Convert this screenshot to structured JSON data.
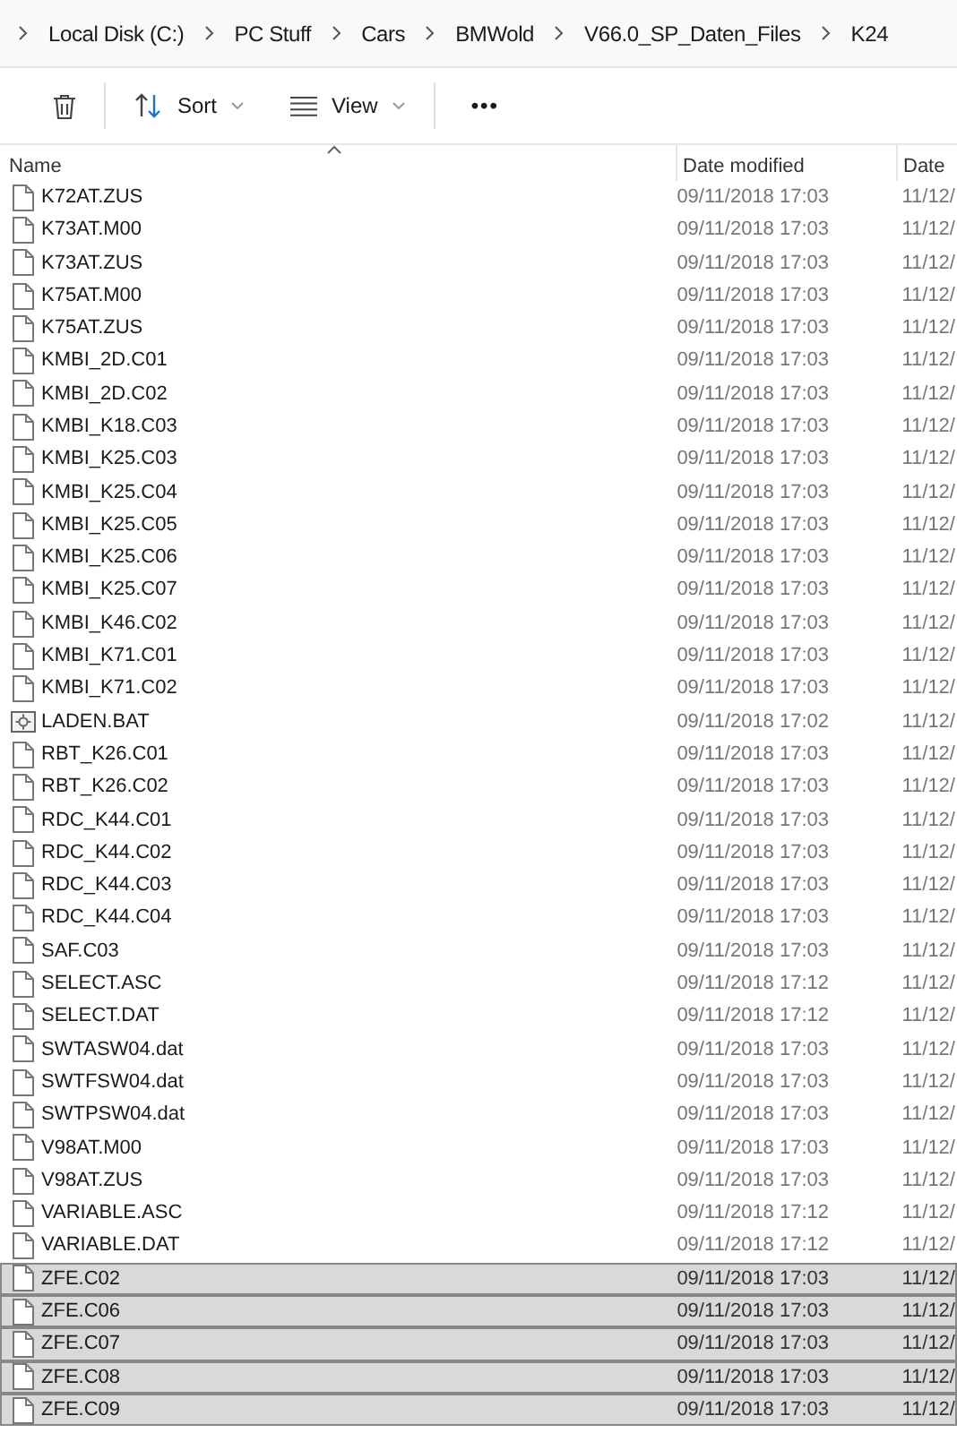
{
  "breadcrumb": [
    "Local Disk (C:)",
    "PC Stuff",
    "Cars",
    "BMWold",
    "V66.0_SP_Daten_Files",
    "K24"
  ],
  "toolbar": {
    "sort": "Sort",
    "view": "View",
    "more": "•••"
  },
  "columns": [
    "Name",
    "Date modified",
    "Date"
  ],
  "files": [
    {
      "name": "K72AT.ZUS",
      "date": "09/11/2018 17:03",
      "column_3": "11/12/",
      "kind": "file",
      "selected": false
    },
    {
      "name": "K73AT.M00",
      "date": "09/11/2018 17:03",
      "column_3": "11/12/",
      "kind": "file",
      "selected": false
    },
    {
      "name": "K73AT.ZUS",
      "date": "09/11/2018 17:03",
      "column_3": "11/12/",
      "kind": "file",
      "selected": false
    },
    {
      "name": "K75AT.M00",
      "date": "09/11/2018 17:03",
      "column_3": "11/12/",
      "kind": "file",
      "selected": false
    },
    {
      "name": "K75AT.ZUS",
      "date": "09/11/2018 17:03",
      "column_3": "11/12/",
      "kind": "file",
      "selected": false
    },
    {
      "name": "KMBI_2D.C01",
      "date": "09/11/2018 17:03",
      "column_3": "11/12/",
      "kind": "file",
      "selected": false
    },
    {
      "name": "KMBI_2D.C02",
      "date": "09/11/2018 17:03",
      "column_3": "11/12/",
      "kind": "file",
      "selected": false
    },
    {
      "name": "KMBI_K18.C03",
      "date": "09/11/2018 17:03",
      "column_3": "11/12/",
      "kind": "file",
      "selected": false
    },
    {
      "name": "KMBI_K25.C03",
      "date": "09/11/2018 17:03",
      "column_3": "11/12/",
      "kind": "file",
      "selected": false
    },
    {
      "name": "KMBI_K25.C04",
      "date": "09/11/2018 17:03",
      "column_3": "11/12/",
      "kind": "file",
      "selected": false
    },
    {
      "name": "KMBI_K25.C05",
      "date": "09/11/2018 17:03",
      "column_3": "11/12/",
      "kind": "file",
      "selected": false
    },
    {
      "name": "KMBI_K25.C06",
      "date": "09/11/2018 17:03",
      "column_3": "11/12/",
      "kind": "file",
      "selected": false
    },
    {
      "name": "KMBI_K25.C07",
      "date": "09/11/2018 17:03",
      "column_3": "11/12/",
      "kind": "file",
      "selected": false
    },
    {
      "name": "KMBI_K46.C02",
      "date": "09/11/2018 17:03",
      "column_3": "11/12/",
      "kind": "file",
      "selected": false
    },
    {
      "name": "KMBI_K71.C01",
      "date": "09/11/2018 17:03",
      "column_3": "11/12/",
      "kind": "file",
      "selected": false
    },
    {
      "name": "KMBI_K71.C02",
      "date": "09/11/2018 17:03",
      "column_3": "11/12/",
      "kind": "file",
      "selected": false
    },
    {
      "name": "LADEN.BAT",
      "date": "09/11/2018 17:02",
      "column_3": "11/12/",
      "kind": "batch",
      "selected": false
    },
    {
      "name": "RBT_K26.C01",
      "date": "09/11/2018 17:03",
      "column_3": "11/12/",
      "kind": "file",
      "selected": false
    },
    {
      "name": "RBT_K26.C02",
      "date": "09/11/2018 17:03",
      "column_3": "11/12/",
      "kind": "file",
      "selected": false
    },
    {
      "name": "RDC_K44.C01",
      "date": "09/11/2018 17:03",
      "column_3": "11/12/",
      "kind": "file",
      "selected": false
    },
    {
      "name": "RDC_K44.C02",
      "date": "09/11/2018 17:03",
      "column_3": "11/12/",
      "kind": "file",
      "selected": false
    },
    {
      "name": "RDC_K44.C03",
      "date": "09/11/2018 17:03",
      "column_3": "11/12/",
      "kind": "file",
      "selected": false
    },
    {
      "name": "RDC_K44.C04",
      "date": "09/11/2018 17:03",
      "column_3": "11/12/",
      "kind": "file",
      "selected": false
    },
    {
      "name": "SAF.C03",
      "date": "09/11/2018 17:03",
      "column_3": "11/12/",
      "kind": "file",
      "selected": false
    },
    {
      "name": "SELECT.ASC",
      "date": "09/11/2018 17:12",
      "column_3": "11/12/",
      "kind": "file",
      "selected": false
    },
    {
      "name": "SELECT.DAT",
      "date": "09/11/2018 17:12",
      "column_3": "11/12/",
      "kind": "file",
      "selected": false
    },
    {
      "name": "SWTASW04.dat",
      "date": "09/11/2018 17:03",
      "column_3": "11/12/",
      "kind": "file",
      "selected": false
    },
    {
      "name": "SWTFSW04.dat",
      "date": "09/11/2018 17:03",
      "column_3": "11/12/",
      "kind": "file",
      "selected": false
    },
    {
      "name": "SWTPSW04.dat",
      "date": "09/11/2018 17:03",
      "column_3": "11/12/",
      "kind": "file",
      "selected": false
    },
    {
      "name": "V98AT.M00",
      "date": "09/11/2018 17:03",
      "column_3": "11/12/",
      "kind": "file",
      "selected": false
    },
    {
      "name": "V98AT.ZUS",
      "date": "09/11/2018 17:03",
      "column_3": "11/12/",
      "kind": "file",
      "selected": false
    },
    {
      "name": "VARIABLE.ASC",
      "date": "09/11/2018 17:12",
      "column_3": "11/12/",
      "kind": "file",
      "selected": false
    },
    {
      "name": "VARIABLE.DAT",
      "date": "09/11/2018 17:12",
      "column_3": "11/12/",
      "kind": "file",
      "selected": false
    },
    {
      "name": "ZFE.C02",
      "date": "09/11/2018 17:03",
      "column_3": "11/12/",
      "kind": "file",
      "selected": true
    },
    {
      "name": "ZFE.C06",
      "date": "09/11/2018 17:03",
      "column_3": "11/12/",
      "kind": "file",
      "selected": true
    },
    {
      "name": "ZFE.C07",
      "date": "09/11/2018 17:03",
      "column_3": "11/12/",
      "kind": "file",
      "selected": true
    },
    {
      "name": "ZFE.C08",
      "date": "09/11/2018 17:03",
      "column_3": "11/12/",
      "kind": "file",
      "selected": true
    },
    {
      "name": "ZFE.C09",
      "date": "09/11/2018 17:03",
      "column_3": "11/12/",
      "kind": "file",
      "selected": true
    }
  ]
}
